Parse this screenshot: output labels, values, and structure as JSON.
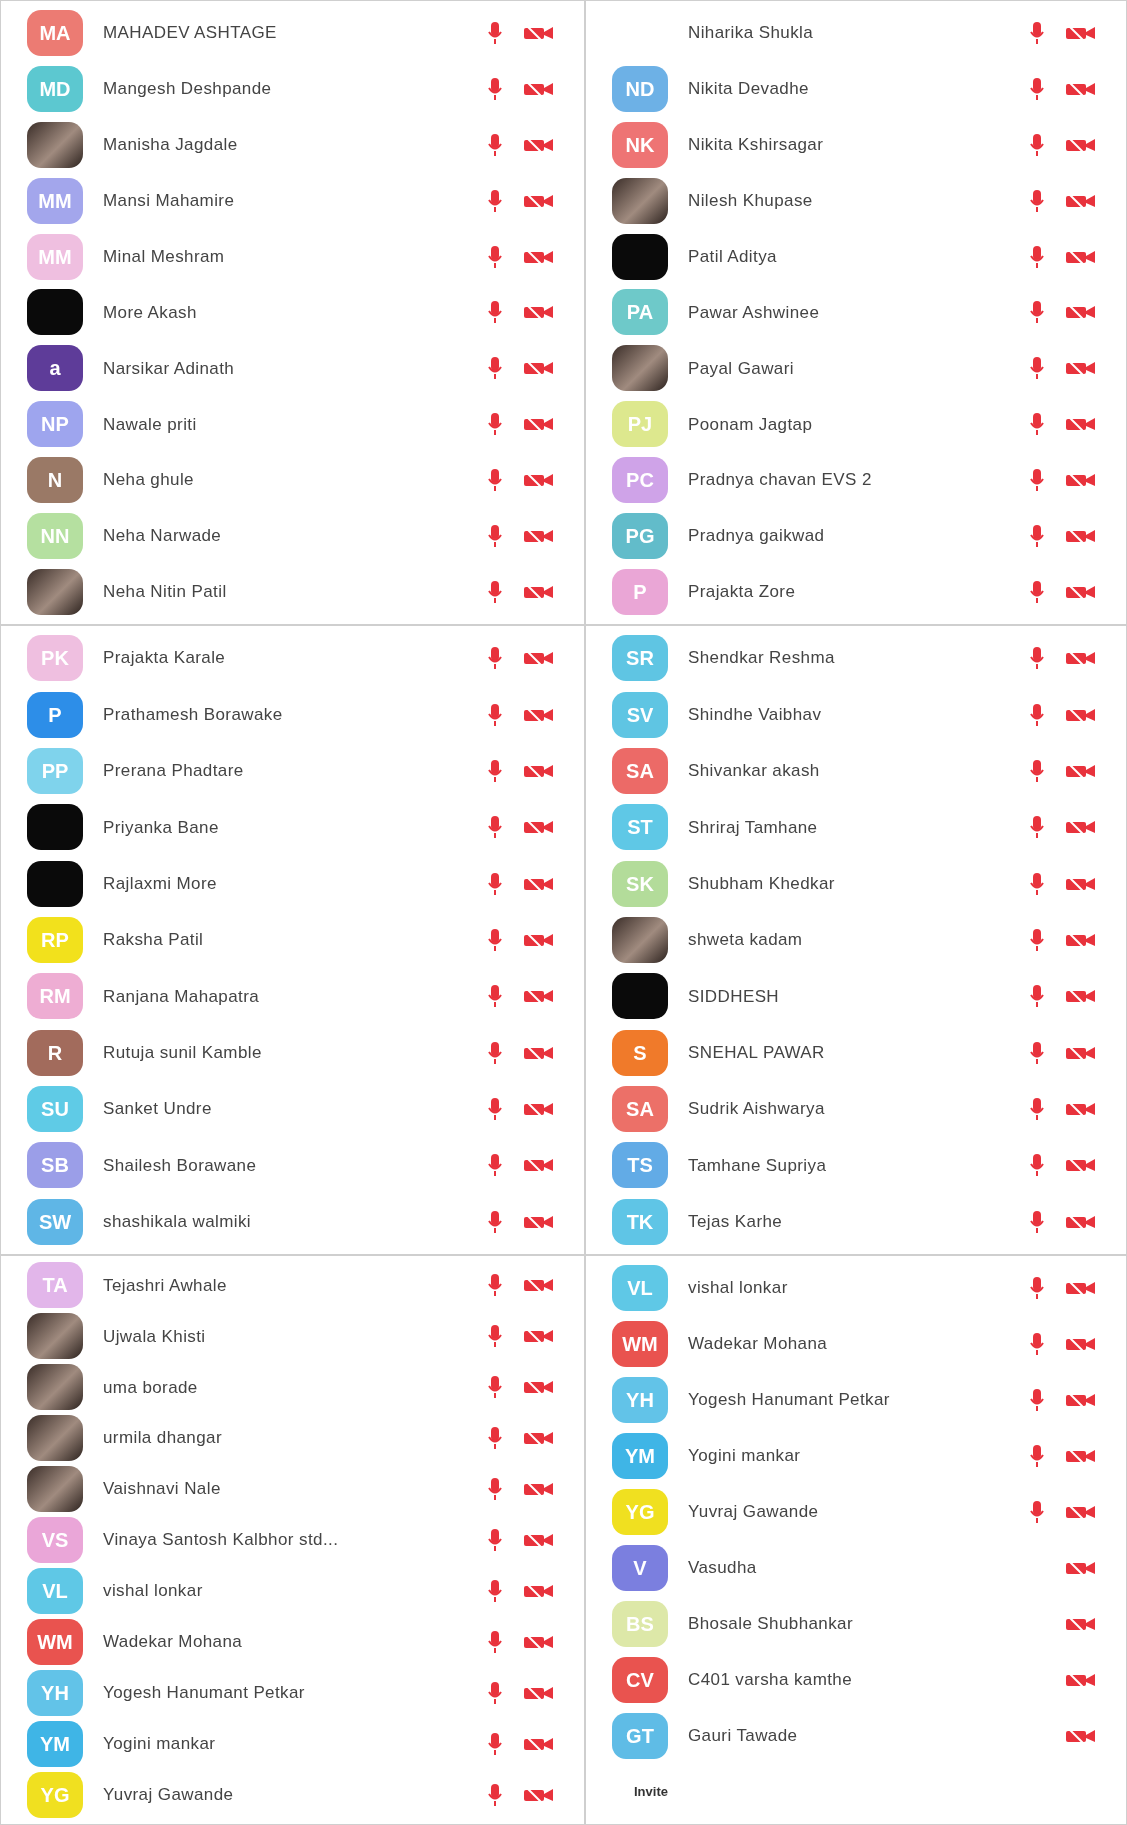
{
  "panels": [
    {
      "participants": [
        {
          "name": "MAHADEV ASHTAGE",
          "avatar": {
            "kind": "initials",
            "initials": "MA",
            "color": "#ec7b73"
          },
          "mic": true
        },
        {
          "name": "Mangesh Deshpande",
          "avatar": {
            "kind": "initials",
            "initials": "MD",
            "color": "#5cc8d0"
          },
          "mic": true
        },
        {
          "name": "Manisha Jagdale",
          "avatar": {
            "kind": "photo"
          },
          "mic": true
        },
        {
          "name": "Mansi Mahamire",
          "avatar": {
            "kind": "initials",
            "initials": "MM",
            "color": "#a3a6ec"
          },
          "mic": true
        },
        {
          "name": "Minal Meshram",
          "avatar": {
            "kind": "initials",
            "initials": "MM",
            "color": "#efbfe0"
          },
          "mic": true
        },
        {
          "name": "More Akash",
          "avatar": {
            "kind": "blank"
          },
          "mic": true
        },
        {
          "name": "Narsikar Adinath",
          "avatar": {
            "kind": "initials",
            "initials": "a",
            "color": "#5e3c99"
          },
          "mic": true
        },
        {
          "name": "Nawale priti",
          "avatar": {
            "kind": "initials",
            "initials": "NP",
            "color": "#9ea5ee"
          },
          "mic": true
        },
        {
          "name": "Neha ghule",
          "avatar": {
            "kind": "initials",
            "initials": "N",
            "color": "#9a7966"
          },
          "mic": true
        },
        {
          "name": "Neha Narwade",
          "avatar": {
            "kind": "initials",
            "initials": "NN",
            "color": "#b5e0a0"
          },
          "mic": true
        },
        {
          "name": "Neha Nitin Patil",
          "avatar": {
            "kind": "photo"
          },
          "mic": true
        }
      ]
    },
    {
      "participants": [
        {
          "name": "Niharika Shukla",
          "avatar": {
            "kind": "none"
          },
          "mic": true
        },
        {
          "name": "Nikita Devadhe",
          "avatar": {
            "kind": "initials",
            "initials": "ND",
            "color": "#6db1e6"
          },
          "mic": true
        },
        {
          "name": "Nikita Kshirsagar",
          "avatar": {
            "kind": "initials",
            "initials": "NK",
            "color": "#ee7474"
          },
          "mic": true
        },
        {
          "name": "Nilesh Khupase",
          "avatar": {
            "kind": "photo"
          },
          "mic": true
        },
        {
          "name": "Patil Aditya",
          "avatar": {
            "kind": "blank"
          },
          "mic": true
        },
        {
          "name": "Pawar Ashwinee",
          "avatar": {
            "kind": "initials",
            "initials": "PA",
            "color": "#6ec9c9"
          },
          "mic": true
        },
        {
          "name": "Payal Gawari",
          "avatar": {
            "kind": "photo"
          },
          "mic": true
        },
        {
          "name": "Poonam Jagtap",
          "avatar": {
            "kind": "initials",
            "initials": "PJ",
            "color": "#dde88e"
          },
          "mic": true
        },
        {
          "name": "Pradnya chavan EVS 2",
          "avatar": {
            "kind": "initials",
            "initials": "PC",
            "color": "#cfa3e8"
          },
          "mic": true
        },
        {
          "name": "Pradnya gaikwad",
          "avatar": {
            "kind": "initials",
            "initials": "PG",
            "color": "#62bcca"
          },
          "mic": true
        },
        {
          "name": "Prajakta Zore",
          "avatar": {
            "kind": "initials",
            "initials": "P",
            "color": "#eaa6d6"
          },
          "mic": true
        }
      ]
    },
    {
      "participants": [
        {
          "name": "Prajakta Karale",
          "avatar": {
            "kind": "initials",
            "initials": "PK",
            "color": "#efbfe0"
          },
          "mic": true
        },
        {
          "name": "Prathamesh Borawake",
          "avatar": {
            "kind": "initials",
            "initials": "P",
            "color": "#2d8ee8"
          },
          "mic": true
        },
        {
          "name": "Prerana Phadtare",
          "avatar": {
            "kind": "initials",
            "initials": "PP",
            "color": "#7fd3ec"
          },
          "mic": true
        },
        {
          "name": "Priyanka Bane",
          "avatar": {
            "kind": "blank"
          },
          "mic": true
        },
        {
          "name": "Rajlaxmi More",
          "avatar": {
            "kind": "blank"
          },
          "mic": true
        },
        {
          "name": "Raksha Patil",
          "avatar": {
            "kind": "initials",
            "initials": "RP",
            "color": "#f2e11c"
          },
          "mic": true
        },
        {
          "name": "Ranjana Mahapatra",
          "avatar": {
            "kind": "initials",
            "initials": "RM",
            "color": "#eeadd3"
          },
          "mic": true
        },
        {
          "name": "Rutuja sunil Kamble",
          "avatar": {
            "kind": "initials",
            "initials": "R",
            "color": "#a26b5c"
          },
          "mic": true
        },
        {
          "name": "Sanket Undre",
          "avatar": {
            "kind": "initials",
            "initials": "SU",
            "color": "#5fcbe6"
          },
          "mic": true
        },
        {
          "name": "Shailesh Borawane",
          "avatar": {
            "kind": "initials",
            "initials": "SB",
            "color": "#9b9ee8"
          },
          "mic": true
        },
        {
          "name": "shashikala walmiki",
          "avatar": {
            "kind": "initials",
            "initials": "SW",
            "color": "#5fb6e6"
          },
          "mic": true
        }
      ]
    },
    {
      "participants": [
        {
          "name": "Shendkar Reshma",
          "avatar": {
            "kind": "initials",
            "initials": "SR",
            "color": "#5fc5e3"
          },
          "mic": true
        },
        {
          "name": "Shindhe Vaibhav",
          "avatar": {
            "kind": "initials",
            "initials": "SV",
            "color": "#5fc5e3"
          },
          "mic": true
        },
        {
          "name": "Shivankar akash",
          "avatar": {
            "kind": "initials",
            "initials": "SA",
            "color": "#ec6a67"
          },
          "mic": true
        },
        {
          "name": "Shriraj Tamhane",
          "avatar": {
            "kind": "initials",
            "initials": "ST",
            "color": "#5fc8e6"
          },
          "mic": true
        },
        {
          "name": "Shubham Khedkar",
          "avatar": {
            "kind": "initials",
            "initials": "SK",
            "color": "#b3dc9a"
          },
          "mic": true
        },
        {
          "name": "shweta kadam",
          "avatar": {
            "kind": "photo"
          },
          "mic": true
        },
        {
          "name": "SIDDHESH",
          "avatar": {
            "kind": "blank"
          },
          "mic": true
        },
        {
          "name": "SNEHAL PAWAR",
          "avatar": {
            "kind": "initials",
            "initials": "S",
            "color": "#f07a2a"
          },
          "mic": true
        },
        {
          "name": "Sudrik Aishwarya",
          "avatar": {
            "kind": "initials",
            "initials": "SA",
            "color": "#ec7068"
          },
          "mic": true
        },
        {
          "name": "Tamhane Supriya",
          "avatar": {
            "kind": "initials",
            "initials": "TS",
            "color": "#62abe6"
          },
          "mic": true
        },
        {
          "name": "Tejas Karhe",
          "avatar": {
            "kind": "initials",
            "initials": "TK",
            "color": "#5fc5e6"
          },
          "mic": true
        }
      ]
    },
    {
      "participants": [
        {
          "name": "Tejashri Awhale",
          "avatar": {
            "kind": "initials",
            "initials": "TA",
            "color": "#e2b6ea"
          },
          "mic": true
        },
        {
          "name": "Ujwala Khisti",
          "avatar": {
            "kind": "photo"
          },
          "mic": true
        },
        {
          "name": "uma borade",
          "avatar": {
            "kind": "photo"
          },
          "mic": true
        },
        {
          "name": "urmila dhangar",
          "avatar": {
            "kind": "photo"
          },
          "mic": true
        },
        {
          "name": "Vaishnavi Nale",
          "avatar": {
            "kind": "photo"
          },
          "mic": true
        },
        {
          "name": "Vinaya Santosh Kalbhor std...",
          "avatar": {
            "kind": "initials",
            "initials": "VS",
            "color": "#eaa6d8"
          },
          "mic": true
        },
        {
          "name": "vishal lonkar",
          "avatar": {
            "kind": "initials",
            "initials": "VL",
            "color": "#5fc8e6"
          },
          "mic": true
        },
        {
          "name": "Wadekar Mohana",
          "avatar": {
            "kind": "initials",
            "initials": "WM",
            "color": "#e9534f"
          },
          "mic": true
        },
        {
          "name": "Yogesh Hanumant Petkar",
          "avatar": {
            "kind": "initials",
            "initials": "YH",
            "color": "#62c3e8"
          },
          "mic": true
        },
        {
          "name": "Yogini mankar",
          "avatar": {
            "kind": "initials",
            "initials": "YM",
            "color": "#3fb5e6"
          },
          "mic": true
        },
        {
          "name": "Yuvraj Gawande",
          "avatar": {
            "kind": "initials",
            "initials": "YG",
            "color": "#f0e020"
          },
          "mic": true
        }
      ]
    },
    {
      "participants": [
        {
          "name": "vishal lonkar",
          "avatar": {
            "kind": "initials",
            "initials": "VL",
            "color": "#5fc8e6"
          },
          "mic": true
        },
        {
          "name": "Wadekar Mohana",
          "avatar": {
            "kind": "initials",
            "initials": "WM",
            "color": "#e9534f"
          },
          "mic": true
        },
        {
          "name": "Yogesh Hanumant Petkar",
          "avatar": {
            "kind": "initials",
            "initials": "YH",
            "color": "#62c3e8"
          },
          "mic": true
        },
        {
          "name": "Yogini mankar",
          "avatar": {
            "kind": "initials",
            "initials": "YM",
            "color": "#3fb5e6"
          },
          "mic": true
        },
        {
          "name": "Yuvraj Gawande",
          "avatar": {
            "kind": "initials",
            "initials": "YG",
            "color": "#f0e020"
          },
          "mic": true
        },
        {
          "name": "Vasudha",
          "avatar": {
            "kind": "initials",
            "initials": "V",
            "color": "#7b7fdf"
          },
          "mic": false
        },
        {
          "name": "Bhosale Shubhankar",
          "avatar": {
            "kind": "initials",
            "initials": "BS",
            "color": "#dde8a8"
          },
          "mic": false
        },
        {
          "name": "C401 varsha kamthe",
          "avatar": {
            "kind": "initials",
            "initials": "CV",
            "color": "#e9534f"
          },
          "mic": false
        },
        {
          "name": "Gauri Tawade",
          "avatar": {
            "kind": "initials",
            "initials": "GT",
            "color": "#5fbce6"
          },
          "mic": false
        }
      ],
      "invite": "Invite"
    }
  ]
}
